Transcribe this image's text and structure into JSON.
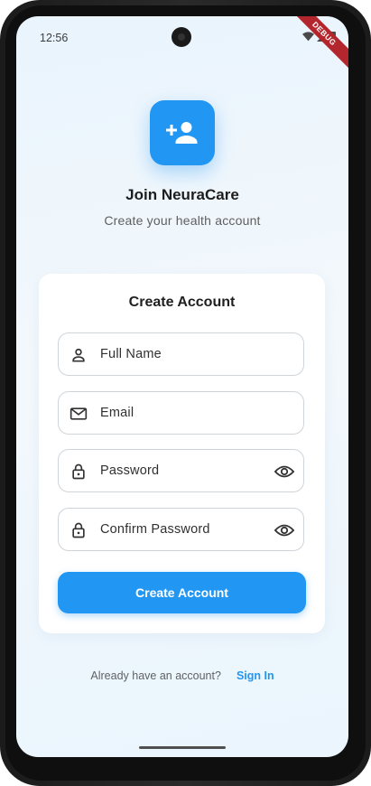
{
  "status_bar": {
    "time": "12:56",
    "debug_banner": "DEBUG"
  },
  "header": {
    "logo_icon": "person-add-icon",
    "title": "Join NeuraCare",
    "subtitle": "Create your health account"
  },
  "form": {
    "title": "Create Account",
    "fields": [
      {
        "label": "Full Name",
        "icon": "person-icon"
      },
      {
        "label": "Email",
        "icon": "mail-icon"
      },
      {
        "label": "Password",
        "icon": "lock-icon",
        "trailing_icon": "eye-icon"
      },
      {
        "label": "Confirm Password",
        "icon": "lock-icon",
        "trailing_icon": "eye-icon"
      }
    ],
    "submit_label": "Create Account"
  },
  "footer": {
    "prompt": "Already have an account?",
    "link": "Sign In"
  },
  "colors": {
    "accent": "#2196f3",
    "debug": "#b3262d"
  }
}
